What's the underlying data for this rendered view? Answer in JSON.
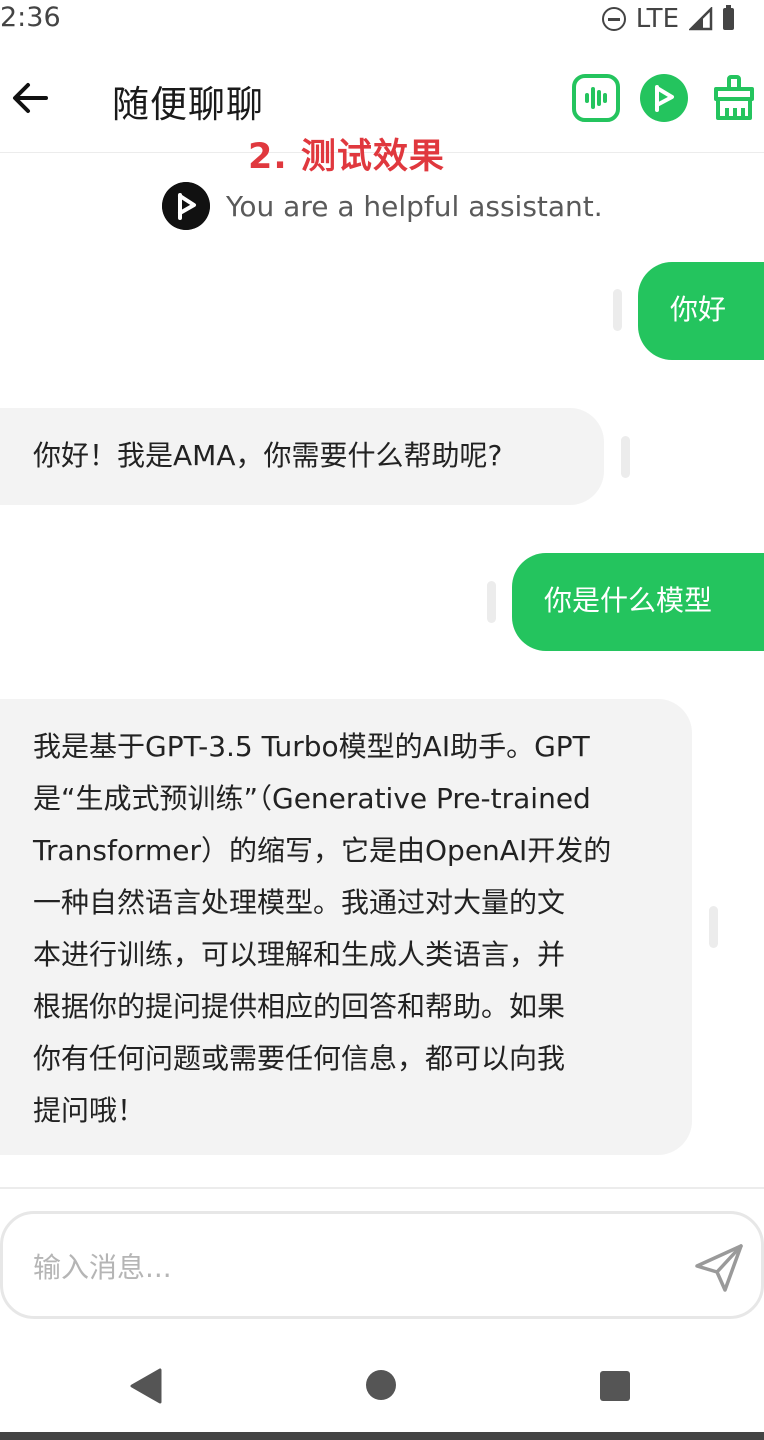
{
  "status_bar": {
    "time": "2:36",
    "network": "LTE"
  },
  "header": {
    "title": "随便聊聊",
    "icons": [
      "back-arrow-icon",
      "voice-wave-icon",
      "flag-icon",
      "broom-icon"
    ],
    "accent_color": "#24c45e"
  },
  "annotation": "2. 测试效果",
  "system_prompt": "You are a helpful assistant.",
  "messages": [
    {
      "role": "user",
      "lines": [
        "你好"
      ]
    },
    {
      "role": "assistant",
      "lines": [
        "你好！我是AMA，你需要什么帮助呢?"
      ]
    },
    {
      "role": "user",
      "lines": [
        "你是什么模型"
      ]
    },
    {
      "role": "assistant",
      "lines": [
        "我是基于GPT-3.5 Turbo模型的AI助手。GPT",
        "是“生成式预训练”（Generative Pre-trained",
        "Transformer）的缩写，它是由OpenAI开发的",
        "一种自然语言处理模型。我通过对大量的文",
        "本进行训练，可以理解和生成人类语言，并",
        "根据你的提问提供相应的回答和帮助。如果",
        "你有任何问题或需要任何信息，都可以向我",
        "提问哦！"
      ]
    }
  ],
  "composer": {
    "placeholder": "输入消息..."
  },
  "nav_bar": {
    "icons": [
      "nav-back-icon",
      "nav-home-icon",
      "nav-recents-icon"
    ]
  }
}
